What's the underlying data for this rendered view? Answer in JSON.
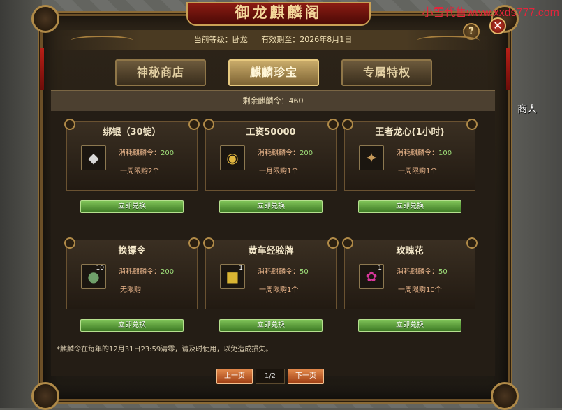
{
  "watermark": "小雪代售www.xxds777.com",
  "npc_sign": "商人",
  "window": {
    "title": "御龙麒麟阁",
    "help_glyph": "?",
    "close_glyph": "✕"
  },
  "header": {
    "level": "当前等级：卧龙",
    "expiry": "有效期至：2026年8月1日"
  },
  "tabs": [
    {
      "label": "神秘商店",
      "active": false
    },
    {
      "label": "麒麟珍宝",
      "active": true
    },
    {
      "label": "专属特权",
      "active": false
    }
  ],
  "remaining": "剩余麒麟令：460",
  "cost_prefix": "消耗麒麟令：",
  "items": [
    {
      "title": "绑银（30锭）",
      "icon": "silver-ingot-icon",
      "glyph": "◆",
      "qty": "",
      "cost": "200",
      "limit": "一周限购2个"
    },
    {
      "title": "工资50000",
      "icon": "gold-coins-icon",
      "glyph": "◉",
      "qty": "",
      "cost": "200",
      "limit": "一月限购1个"
    },
    {
      "title": "王者龙心(1小时)",
      "icon": "dragon-heart-icon",
      "glyph": "✦",
      "qty": "",
      "cost": "100",
      "limit": "一周限购1个"
    },
    {
      "title": "换镖令",
      "icon": "escort-token-icon",
      "glyph": "●",
      "qty": "10",
      "cost": "200",
      "limit": "无限购"
    },
    {
      "title": "黄车经验牌",
      "icon": "yellow-cart-icon",
      "glyph": "■",
      "qty": "1",
      "cost": "50",
      "limit": "一周限购1个"
    },
    {
      "title": "玫瑰花",
      "icon": "rose-icon",
      "glyph": "✿",
      "qty": "1",
      "cost": "50",
      "limit": "一周限购10个"
    }
  ],
  "redeem_label": "立即兑换",
  "footnote": "*麒麟令在每年的12月31日23:59清零，请及时使用，以免造成损失。",
  "pager": {
    "prev": "上一页",
    "page": "1/2",
    "next": "下一页"
  },
  "colors": {
    "accent_gold": "#c9a055",
    "cost_value": "#9fe07a",
    "redeem_green": "#5fa33a",
    "pager_orange": "#c8622a"
  }
}
